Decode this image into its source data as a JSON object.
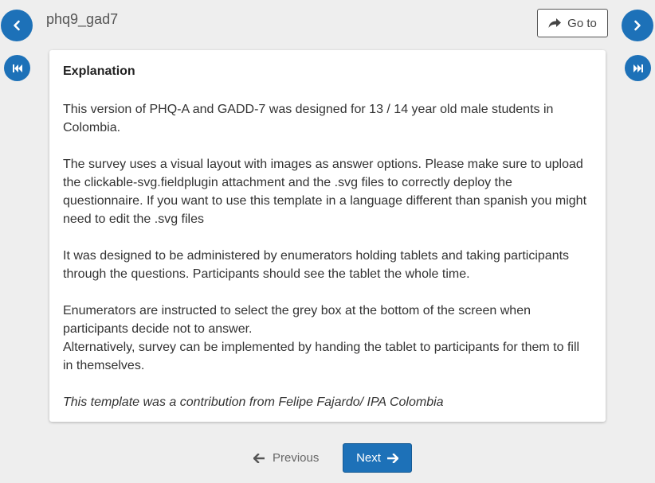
{
  "header": {
    "form_title": "phq9_gad7",
    "goto_label": "Go to"
  },
  "icons": {
    "back": "chevron-left-icon",
    "forward": "chevron-right-icon",
    "first": "skip-to-start-icon",
    "last": "skip-to-end-icon",
    "goto": "share-arrow-icon",
    "previous": "arrow-left-icon",
    "next": "arrow-right-icon"
  },
  "colors": {
    "accent": "#1d71b8",
    "background": "#eeeeee"
  },
  "content": {
    "heading": "Explanation",
    "paragraphs": [
      "This version of PHQ-A and GADD-7 was designed for 13 / 14 year old male students in Colombia.",
      "The survey uses a visual layout with images as answer options. Please make sure to upload the clickable-svg.fieldplugin attachment and the .svg files to correctly deploy the questionnaire. If you want to use this template in a language different than spanish you might need to edit the .svg files",
      "It was designed to be administered by enumerators holding tablets and taking participants through the questions. Participants should see the tablet the whole time.",
      "Enumerators are instructed to select the grey box at the bottom of the screen when participants decide not to answer.",
      "Alternatively, survey can be implemented by handing the tablet to participants for them to fill in themselves.",
      "This template was a contribution from Felipe Fajardo/ IPA Colombia"
    ]
  },
  "navigation": {
    "previous_label": "Previous",
    "next_label": "Next"
  }
}
